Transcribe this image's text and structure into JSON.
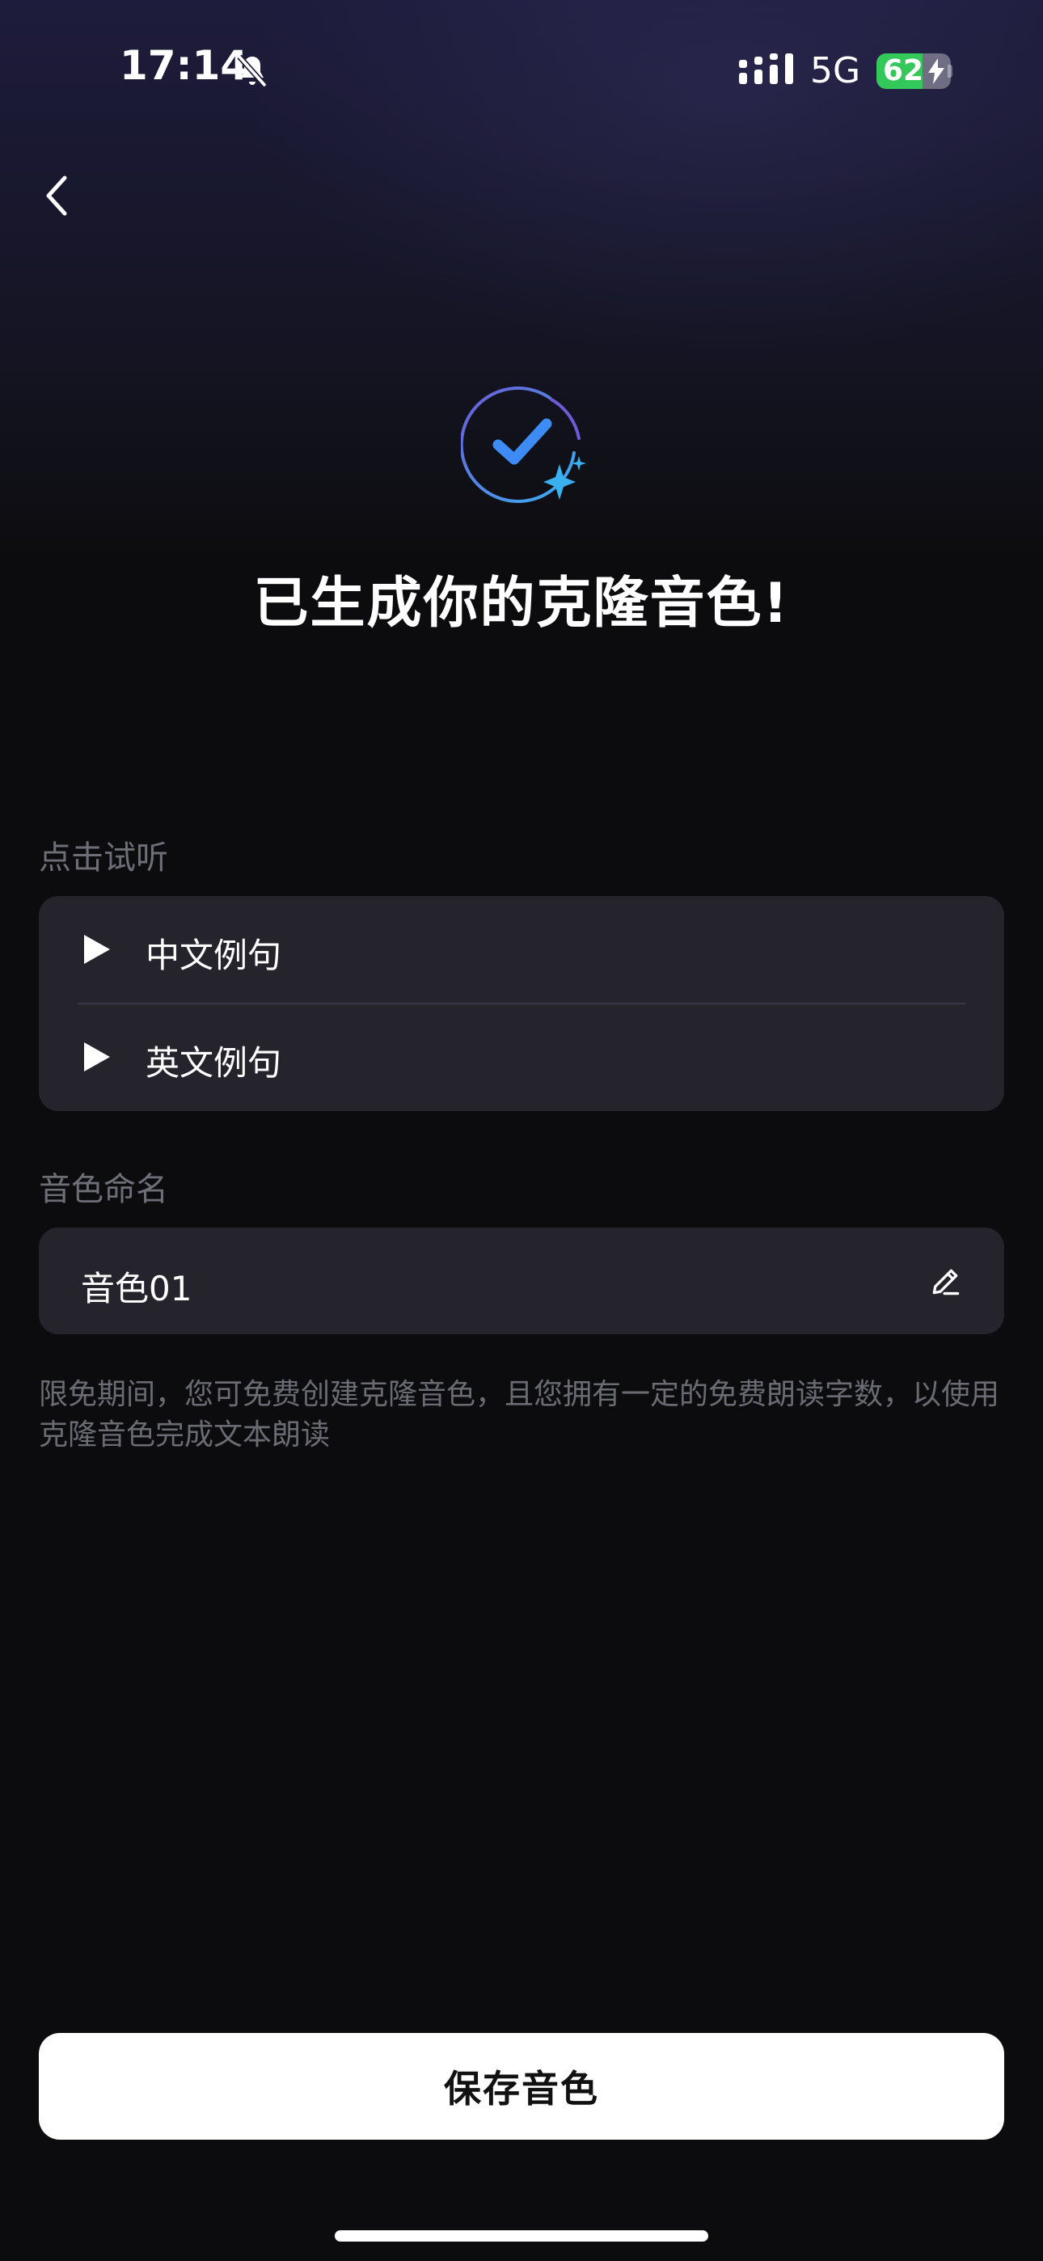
{
  "status_bar": {
    "time": "17:14",
    "network": "5G",
    "battery_percent": "62",
    "battery_level": 0.62,
    "icons": [
      "bell-slash-icon",
      "signal-icon",
      "charging-bolt-icon"
    ]
  },
  "nav": {
    "back_icon": "chevron-left-icon"
  },
  "header": {
    "icon": "check-circle-sparkle-icon",
    "title": "已生成你的克隆音色!"
  },
  "preview": {
    "label": "点击试听",
    "items": [
      {
        "label": "中文例句",
        "icon": "play-icon"
      },
      {
        "label": "英文例句",
        "icon": "play-icon"
      }
    ]
  },
  "naming": {
    "label": "音色命名",
    "value": "音色01",
    "icon": "edit-pencil-icon"
  },
  "notice": "限免期间，您可免费创建克隆音色，且您拥有一定的免费朗读字数，以使用克隆音色完成文本朗读",
  "actions": {
    "save_label": "保存音色"
  },
  "colors": {
    "background": "#0c0c0e",
    "card": "#25242d",
    "accent_blue": "#3d8cf5",
    "battery_green": "#34c759"
  }
}
